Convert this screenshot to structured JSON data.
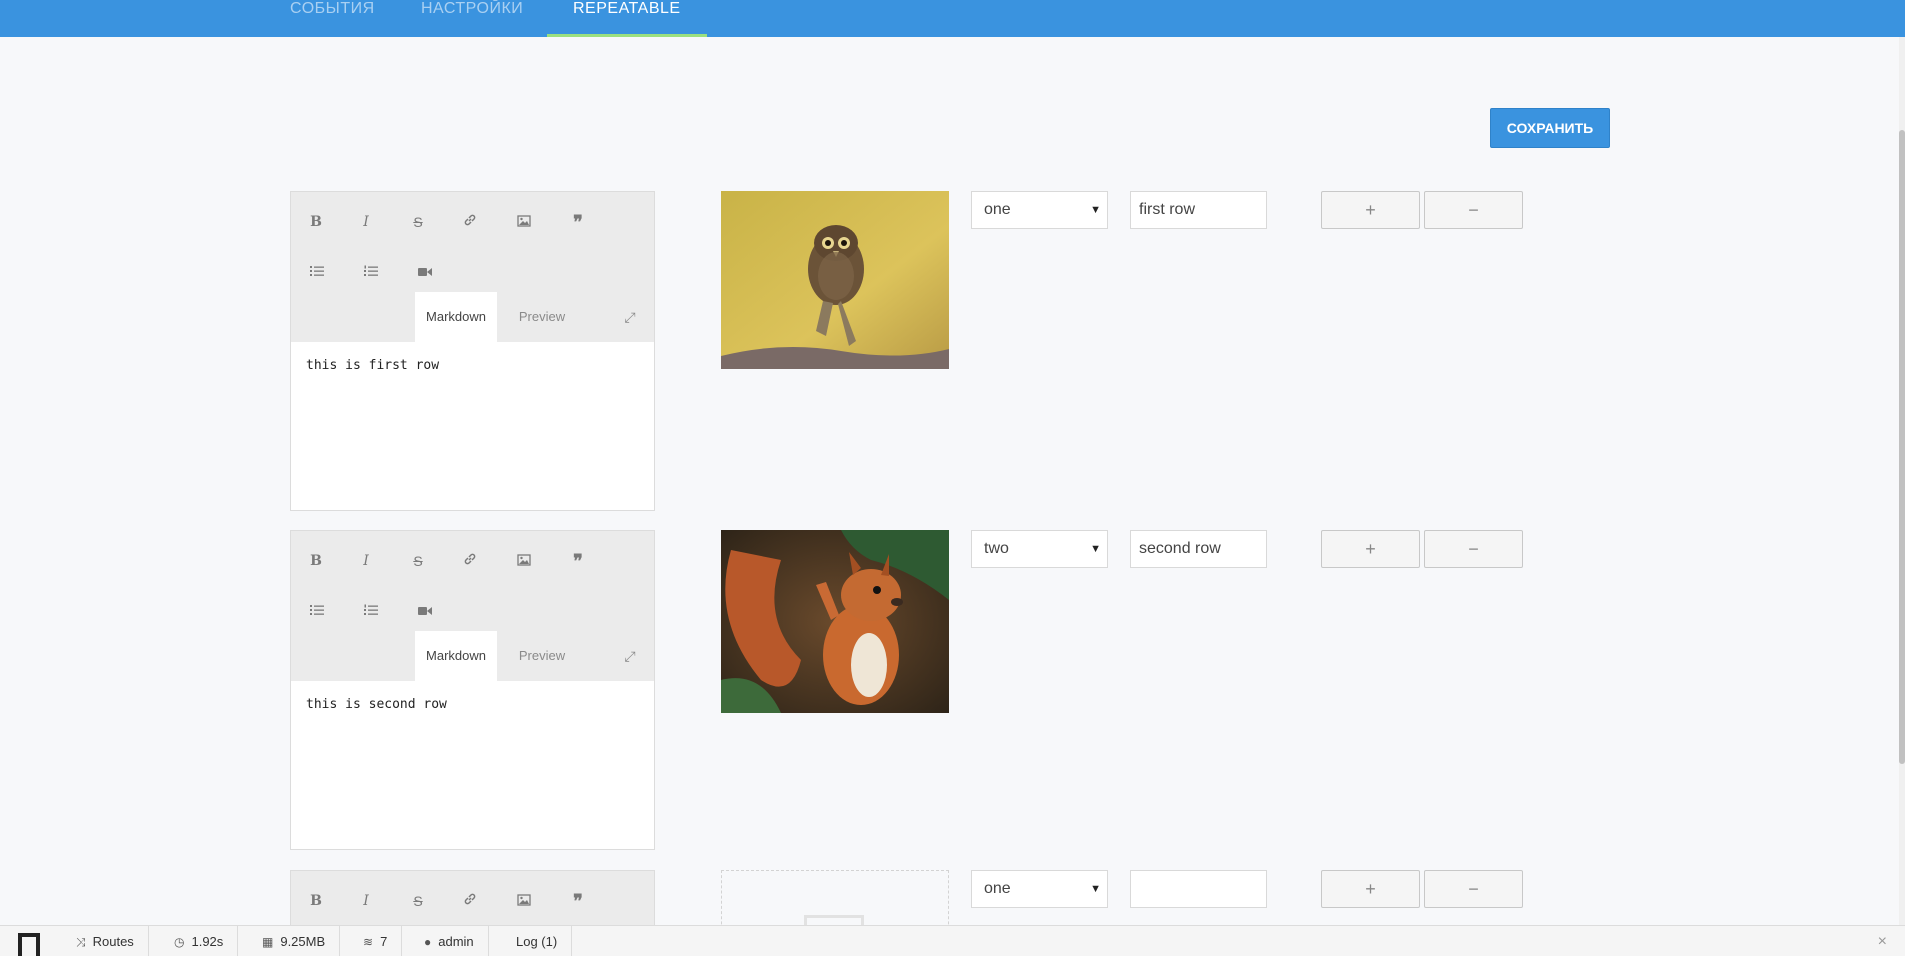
{
  "tabs": [
    {
      "label": "СОБЫТИЯ"
    },
    {
      "label": "НАСТРОЙКИ"
    },
    {
      "label": "REPEATABLE"
    }
  ],
  "save_button": {
    "label": "СОХРАНИТЬ"
  },
  "editor_toolbar": {
    "icons": [
      "bold-icon",
      "italic-icon",
      "strikethrough-icon",
      "link-icon",
      "image-icon",
      "quote-icon",
      "unordered-list-icon",
      "ordered-list-icon",
      "video-icon",
      "expand-icon"
    ],
    "bold": "B",
    "italic": "I",
    "strike": "S",
    "mode_markdown": "Markdown",
    "mode_preview": "Preview"
  },
  "rows": [
    {
      "text": "this is first row",
      "select_value": "one",
      "input_value": "first row",
      "image": "owl-photo"
    },
    {
      "text": "this is second row",
      "select_value": "two",
      "input_value": "second row",
      "image": "squirrel-photo"
    },
    {
      "text": "",
      "select_value": "one",
      "input_value": "",
      "image": ""
    }
  ],
  "row_buttons": {
    "add": "+",
    "remove": "−"
  },
  "debugbar": {
    "routes": "Routes",
    "time": "1.92s",
    "memory": "9.25MB",
    "queries": "7",
    "user": "admin",
    "log": "Log (1)",
    "close": "×"
  },
  "colors": {
    "accent": "#3a93df",
    "active_tab_underline": "#9be07f",
    "page_bg": "#f7f8fa"
  }
}
